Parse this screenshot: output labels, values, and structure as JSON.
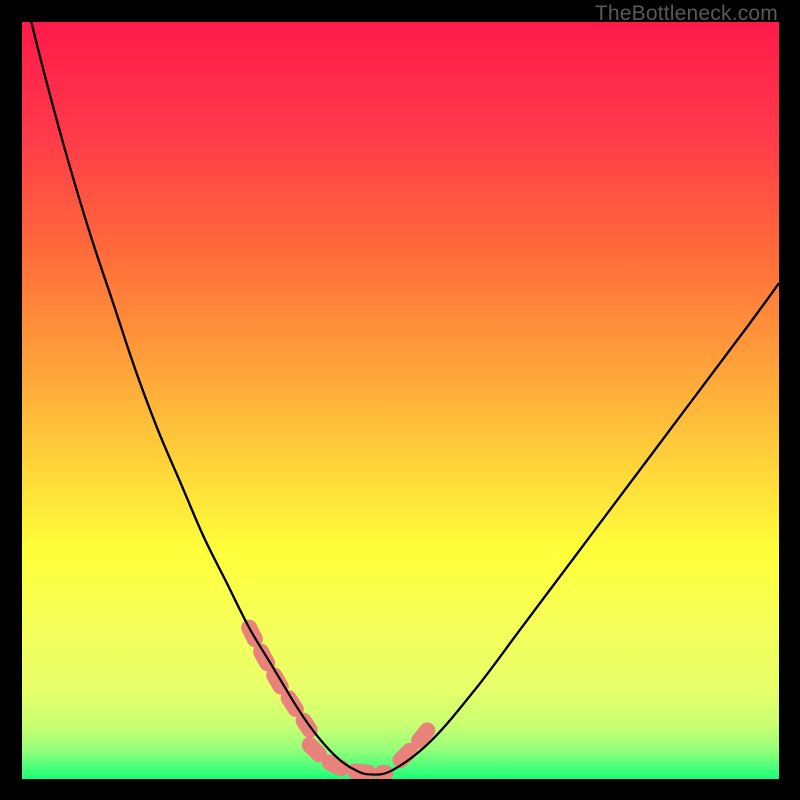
{
  "watermark": "TheBottleneck.com",
  "chart_data": {
    "type": "line",
    "title": "",
    "xlabel": "",
    "ylabel": "",
    "xlim": [
      0,
      100
    ],
    "ylim": [
      0,
      100
    ],
    "grid": false,
    "series": [
      {
        "name": "bottleneck-curve",
        "x": [
          0,
          3,
          6,
          9,
          12,
          15,
          18,
          21,
          24,
          27,
          30,
          33,
          36,
          38,
          40,
          42,
          44,
          46,
          49,
          54,
          60,
          66,
          72,
          78,
          84,
          90,
          96,
          100
        ],
        "y": [
          105,
          93,
          82,
          72,
          63,
          54,
          46,
          39,
          32,
          26,
          20,
          15,
          10,
          7,
          4.5,
          2.5,
          1.2,
          0.6,
          1.2,
          5,
          12,
          20,
          28,
          36,
          44,
          52,
          60,
          65.5
        ]
      },
      {
        "name": "highlight-segment-left",
        "x": [
          30,
          32,
          34,
          36,
          38
        ],
        "y": [
          20,
          16,
          12.5,
          9.5,
          6.5
        ]
      },
      {
        "name": "highlight-segment-bottom",
        "x": [
          38,
          40,
          42,
          44,
          46,
          48
        ],
        "y": [
          4.5,
          2.5,
          1.5,
          1.0,
          0.8,
          0.8
        ]
      },
      {
        "name": "highlight-segment-right",
        "x": [
          50,
          52,
          54
        ],
        "y": [
          2.5,
          4.5,
          7
        ]
      }
    ],
    "background_gradient": {
      "type": "vertical",
      "colors": [
        "#ff1a4a",
        "#ff6a3a",
        "#ffd23a",
        "#ffff3a",
        "#e8ff6a",
        "#9aff7a",
        "#1aff7a"
      ]
    },
    "highlight_color": "#e8827a",
    "curve_color": "#000000"
  }
}
